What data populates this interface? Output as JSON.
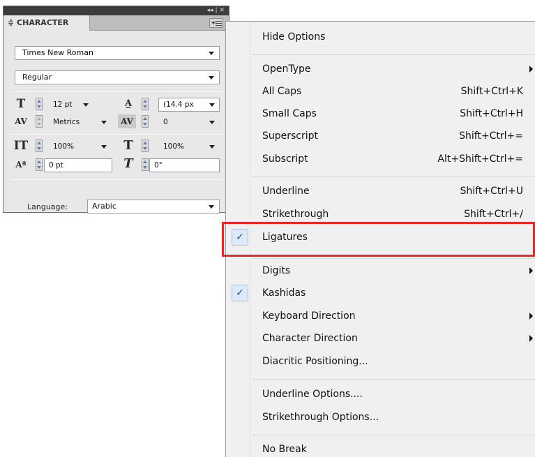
{
  "panel": {
    "title_controls": "◂◂ | ✕",
    "tab_label": "≑ CHARACTER",
    "font_family": "Times New Roman",
    "font_style": "Regular",
    "font_size": "12 pt",
    "leading": "(14.4 px",
    "kerning": "Metrics",
    "tracking": "0",
    "vertical_scale": "100%",
    "horizontal_scale": "100%",
    "baseline_shift": "0 pt",
    "skew": "0°",
    "language_label": "Language:",
    "language_value": "Arabic"
  },
  "menu": {
    "items": [
      {
        "label": "Hide Options",
        "shortcut": ""
      },
      {
        "label": "OpenType",
        "shortcut": ""
      },
      {
        "label": "All Caps",
        "shortcut": "Shift+Ctrl+K"
      },
      {
        "label": "Small Caps",
        "shortcut": "Shift+Ctrl+H"
      },
      {
        "label": "Superscript",
        "shortcut": "Shift+Ctrl+="
      },
      {
        "label": "Subscript",
        "shortcut": "Alt+Shift+Ctrl+="
      },
      {
        "label": "Underline",
        "shortcut": "Shift+Ctrl+U"
      },
      {
        "label": "Strikethrough",
        "shortcut": "Shift+Ctrl+/"
      },
      {
        "label": "Ligatures",
        "shortcut": "",
        "checked": true
      },
      {
        "label": "Digits",
        "shortcut": ""
      },
      {
        "label": "Kashidas",
        "shortcut": "",
        "checked": true
      },
      {
        "label": "Keyboard Direction",
        "shortcut": ""
      },
      {
        "label": "Character Direction",
        "shortcut": ""
      },
      {
        "label": "Diacritic Positioning...",
        "shortcut": ""
      },
      {
        "label": "Underline Options....",
        "shortcut": ""
      },
      {
        "label": "Strikethrough Options...",
        "shortcut": ""
      },
      {
        "label": "No Break",
        "shortcut": ""
      }
    ]
  },
  "colors": {
    "highlight": "#e8262b",
    "check": "#1f4fa4",
    "menu_background": "#f0f0f0"
  }
}
